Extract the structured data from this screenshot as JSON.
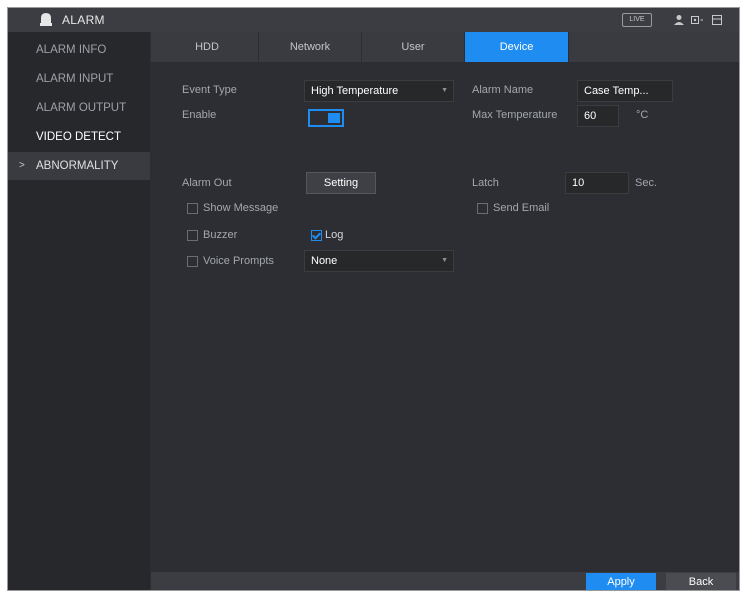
{
  "app": {
    "title": "ALARM",
    "live_badge": "LIVE"
  },
  "sidebar": {
    "items": [
      {
        "label": "ALARM INFO"
      },
      {
        "label": "ALARM INPUT"
      },
      {
        "label": "ALARM OUTPUT"
      },
      {
        "label": "VIDEO DETECT"
      },
      {
        "label": "ABNORMALITY",
        "arrow": ">"
      }
    ]
  },
  "tabs": [
    {
      "label": "HDD"
    },
    {
      "label": "Network"
    },
    {
      "label": "User"
    },
    {
      "label": "Device",
      "active": true
    }
  ],
  "form": {
    "event_type_label": "Event Type",
    "event_type_value": "High Temperature",
    "alarm_name_label": "Alarm Name",
    "alarm_name_value": "Case Temp...",
    "enable_label": "Enable",
    "enable_on": true,
    "max_temp_label": "Max Temperature",
    "max_temp_value": "60",
    "max_temp_unit": "°C",
    "alarm_out_label": "Alarm Out",
    "setting_button": "Setting",
    "latch_label": "Latch",
    "latch_value": "10",
    "latch_unit": "Sec.",
    "show_message_label": "Show Message",
    "show_message_checked": false,
    "send_email_label": "Send Email",
    "send_email_checked": false,
    "buzzer_label": "Buzzer",
    "buzzer_checked": false,
    "log_label": "Log",
    "log_checked": true,
    "voice_prompts_label": "Voice Prompts",
    "voice_prompts_checked": false,
    "voice_prompts_value": "None"
  },
  "footer": {
    "apply_label": "Apply",
    "back_label": "Back"
  },
  "colors": {
    "accent": "#1e8cf0",
    "background": "#2c2e33",
    "sidebar": "#26282c"
  }
}
